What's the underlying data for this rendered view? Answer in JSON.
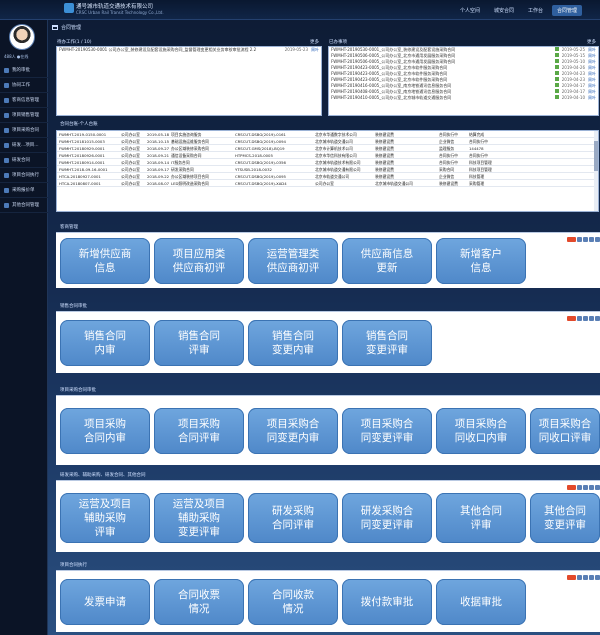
{
  "top": {
    "company_cn": "通号城市轨道交通技术有限公司",
    "company_en": "CRSC Urban Rail Transit Technology Co.,Ltd.",
    "nav": [
      "个人空间",
      "城安合同",
      "工作台",
      "合同管理"
    ],
    "active_nav": "合同管理"
  },
  "sidebar": {
    "user": "488人 ●在线",
    "items": [
      {
        "label": "我的审批"
      },
      {
        "label": "协同工作"
      },
      {
        "label": "客商信息管理"
      },
      {
        "label": "项目销售管理"
      },
      {
        "label": "项目采购合同"
      },
      {
        "label": "研发...项目..."
      },
      {
        "label": "研发合同"
      },
      {
        "label": "项目合同执行"
      },
      {
        "label": "采购报价单"
      },
      {
        "label": "其他合同管理"
      }
    ]
  },
  "breadcrumb": "合同管理",
  "panel_left": {
    "title": "待办工作(1 / 10)",
    "more": "更多",
    "rows": [
      {
        "text": "FWMHT-20190530-0001 公司办公室_装修建设及配套设施采购合同_监督管理变更相关业务审核审批流程 2.2",
        "date": "2019-05-23",
        "author": "周叶"
      }
    ]
  },
  "panel_right": {
    "title": "已办事项",
    "more": "更多",
    "rows": [
      {
        "text": "FWMHT-20190530-0001_公司办公室_装修建设及配套设施采购合同",
        "date": "2019-05-25",
        "author": "周叶"
      },
      {
        "text": "FWMHT-20190506-0005_公司办公室_北京市通用发展服务采购合同",
        "date": "2019-05-15",
        "author": "周叶"
      },
      {
        "text": "FWMHT-20190506-0005_公司办公室_北京市通用发展服务采购合同",
        "date": "2019-05-10",
        "author": "周叶"
      },
      {
        "text": "FWMHT-20190423-0005_公司办公室_北京市软件服务采购合同",
        "date": "2019-04-26",
        "author": "周叶"
      },
      {
        "text": "FWMHT-20190423-0005_公司办公室_北京市软件服务采购合同",
        "date": "2019-04-23",
        "author": "周叶"
      },
      {
        "text": "FWMHT-20190423-0005_公司办公室_北京市软件服务采购合同",
        "date": "2019-04-23",
        "author": "周叶"
      },
      {
        "text": "FWMHT-20190416-0005_公司办公室_南京地铁通讯信息服务合同",
        "date": "2019-04-17",
        "author": "周叶"
      },
      {
        "text": "FWMHT-20190408-0005_公司办公室_南京地铁通讯信息服务合同",
        "date": "2019-04-17",
        "author": "周叶"
      },
      {
        "text": "FWMHT-20190410-0005_公司办公室_北京城市轨道交通服务合同",
        "date": "2019-04-10",
        "author": "周叶"
      }
    ]
  },
  "table": {
    "title": "合同台账-个人台账",
    "rows": [
      [
        "FWMHT-2019-0150-0001",
        "公司办公室",
        "2019-05-18",
        "项目实施咨询服务",
        "CRSCUT-DSBG(2019)-0161",
        "北京市华通数字技术公司",
        "装修建设费",
        "合同执行中",
        "结算完成"
      ],
      [
        "FWMHT-20181015-0003",
        "公司办公室",
        "2018-10-15",
        "基础设施运维服务合同",
        "CRSCUT-DSBG(2019)-0094",
        "北京城市轨道交通公司",
        "装修建设费",
        "企业微信",
        "合同执行中"
      ],
      [
        "FWMHT-20180929-0001",
        "公司办公室",
        "2018-09-27",
        "办公区域装修采购合同",
        "CRSCUT-GMS(2018)-BQ19",
        "北京市计算机技术公司",
        "装修建设费",
        "监理服务",
        "144478"
      ],
      [
        "FWMHT-20180926-0001",
        "公司办公室",
        "2018-09-21",
        "通信设备采购合同",
        "HTPMCS-2018-0005",
        "北京市华信科技有限公司",
        "装修建设费",
        "合同执行中",
        "合同执行中"
      ],
      [
        "FWMHT-20180914-0001",
        "公司办公室",
        "2018-09-14",
        "IT服务合同",
        "CRSCUT-DSBG(2019)-0356",
        "北京城市轨道技术有限公司",
        "装修建设费",
        "合同执行中",
        "科技项目管理"
      ],
      [
        "FWMHT-2018-09-16-0001",
        "公司办公室",
        "2018-09-17",
        "研发采购合同",
        "YTSUSB-2018-0032",
        "北京城市轨道交通有限公司",
        "装修建设费",
        "采购合同",
        "科技项目管理"
      ],
      [
        "HTCA-20180927-0001",
        "公司办公室",
        "2018-09-22",
        "办公区域装修项目合同",
        "CRSCUT-DSBG(2019)-0095",
        "北京市轨道交通公司",
        "装修建设费",
        "企业微信",
        "科技管理"
      ],
      [
        "HTCA-20180807-0001",
        "公司办公室",
        "2018-08-07",
        "LED照明改造采购合同",
        "CRSCUT-DSBG(2019)-XAD4",
        "公司办公室",
        "北京城市轨道交通公司",
        "装修建设费",
        "采购管理"
      ]
    ]
  },
  "sections": [
    {
      "label": "客商管理",
      "tiles": [
        "新增供应商\n信息",
        "项目应用类\n供应商初评",
        "运营管理类\n供应商初评",
        "供应商信息\n更新",
        "新增客户\n信息"
      ]
    },
    {
      "label": "销售合同审批",
      "tiles": [
        "销售合同\n内审",
        "销售合同\n评审",
        "销售合同\n变更内审",
        "销售合同\n变更评审"
      ]
    },
    {
      "label": "项目采购合同审批",
      "tiles": [
        "项目采购\n合同内审",
        "项目采购\n合同评审",
        "项目采购合\n同变更内审",
        "项目采购合\n同变更评审",
        "项目采购合\n同收口内审",
        "项目采购合\n同收口评审"
      ]
    },
    {
      "label": "研发采购、辅助采购、研发合同、其他合同",
      "tiles": [
        "运营及项目\n辅助采购\n评审",
        "运营及项目\n辅助采购\n变更评审",
        "研发采购\n合同评审",
        "研发采购合\n同变更评审",
        "其他合同\n评审",
        "其他合同\n变更评审"
      ]
    },
    {
      "label": "项目合同执行",
      "tiles": [
        "发票申请",
        "合同收票\n情况",
        "合同收款\n情况",
        "拨付款审批",
        "收据审批"
      ]
    }
  ]
}
